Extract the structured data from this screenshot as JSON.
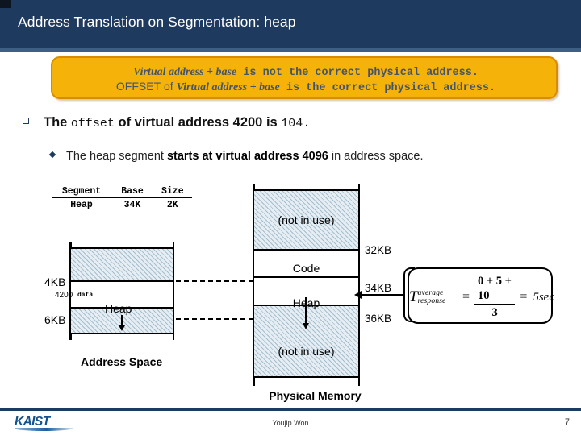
{
  "header": {
    "title": "Address Translation on Segmentation: heap",
    "bg_color": "#1f3a5f",
    "accent_color": "#3d5f86"
  },
  "callout": {
    "bg_color": "#F5B30A",
    "border_color": "#D98C00",
    "text_color": "#44546A",
    "line1_math": "Virtual address + base",
    "line1_rest": "is not the correct physical address.",
    "line2_prefix": "OFFSET",
    "line2_of": "of",
    "line2_math": "Virtual address + base",
    "line2_rest": "is the correct physical address."
  },
  "bullets": {
    "primary": {
      "marker": "hollow-square",
      "part1": "The ",
      "code1": "offset",
      "part2": " of virtual address 4200 is ",
      "code2": "104",
      "part3": "."
    },
    "secondary": {
      "marker": "filled-diamond",
      "part1": "The heap segment ",
      "bold": "starts at virtual address 4096",
      "part2": " in address space."
    }
  },
  "segment_table": {
    "headers": [
      "Segment",
      "Base",
      "Size"
    ],
    "rows": [
      [
        "Heap",
        "34K",
        "2K"
      ]
    ]
  },
  "address_space": {
    "caption": "Address Space",
    "tick_4kb": "4KB",
    "tick_6kb": "6KB",
    "addr_label": "4200",
    "data_label": "data",
    "heap_label": "Heap"
  },
  "physical_memory": {
    "caption": "Physical Memory",
    "block_notinuse_top": "(not in use)",
    "block_code": "Code",
    "block_heap": "Heap",
    "block_notinuse_bottom": "(not in use)",
    "tick_32kb": "32KB",
    "tick_34kb": "34KB",
    "tick_36kb": "36KB"
  },
  "formula_box": {
    "symbol": "T",
    "subscript": "average response",
    "equals": "=",
    "numerator": "0 + 5 + 10",
    "denominator": "3",
    "equals2": "=",
    "result": "5sec"
  },
  "footer": {
    "logo_text": "KAIST",
    "author": "Youjip Won",
    "page_number": "7",
    "rule_color": "#1f3a5f",
    "logo_color": "#12538f"
  }
}
